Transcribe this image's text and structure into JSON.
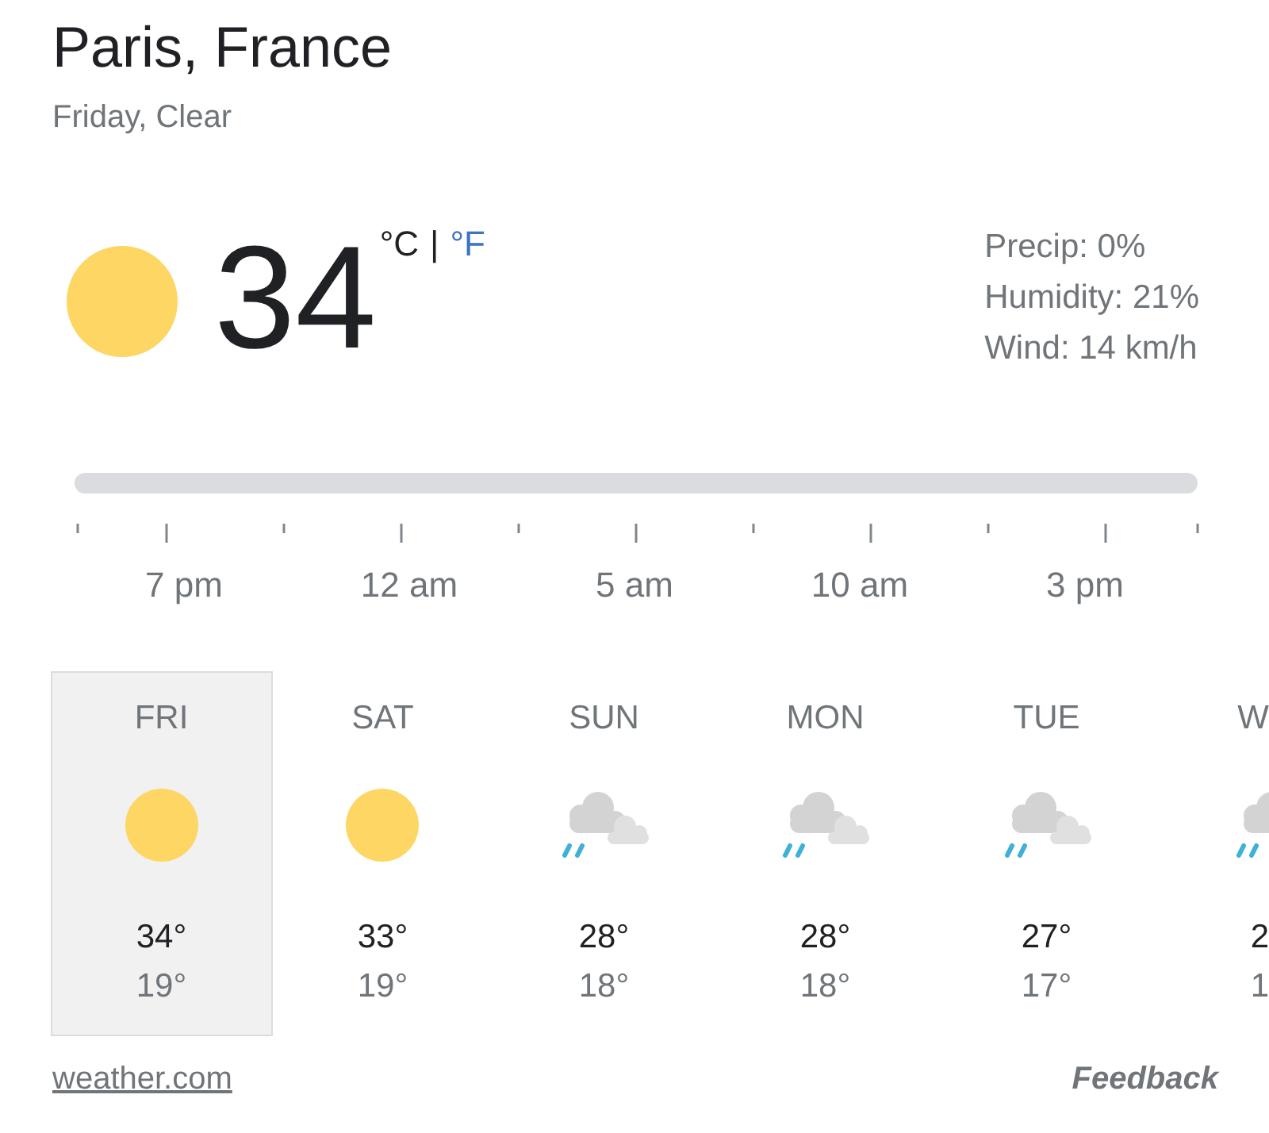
{
  "location": {
    "title": "Paris, France",
    "summary": "Friday, Clear"
  },
  "current": {
    "temperature": "34",
    "units": [
      {
        "label": "°C",
        "selected": true
      },
      {
        "label": "°F",
        "selected": false
      }
    ],
    "unit_separator": "|",
    "details": [
      "Precip: 0%",
      "Humidity: 21%",
      "Wind: 14 km/h"
    ]
  },
  "timeline": {
    "hour_labels": [
      "7 pm",
      "12 am",
      "5 am",
      "10 am",
      "3 pm"
    ]
  },
  "days": [
    {
      "day": "FRI",
      "kind": "sunny",
      "high": "34°",
      "low": "19°",
      "selected": true
    },
    {
      "day": "SAT",
      "kind": "sunny",
      "high": "33°",
      "low": "19°",
      "selected": false
    },
    {
      "day": "SUN",
      "kind": "rain",
      "high": "28°",
      "low": "18°",
      "selected": false
    },
    {
      "day": "MON",
      "kind": "rain",
      "high": "28°",
      "low": "18°",
      "selected": false
    },
    {
      "day": "TUE",
      "kind": "rain",
      "high": "27°",
      "low": "17°",
      "selected": false
    },
    {
      "day": "W",
      "kind": "rain",
      "high": "2",
      "low": "1",
      "selected": false
    }
  ],
  "footer": {
    "source_link": "weather.com",
    "feedback": "Feedback"
  }
}
